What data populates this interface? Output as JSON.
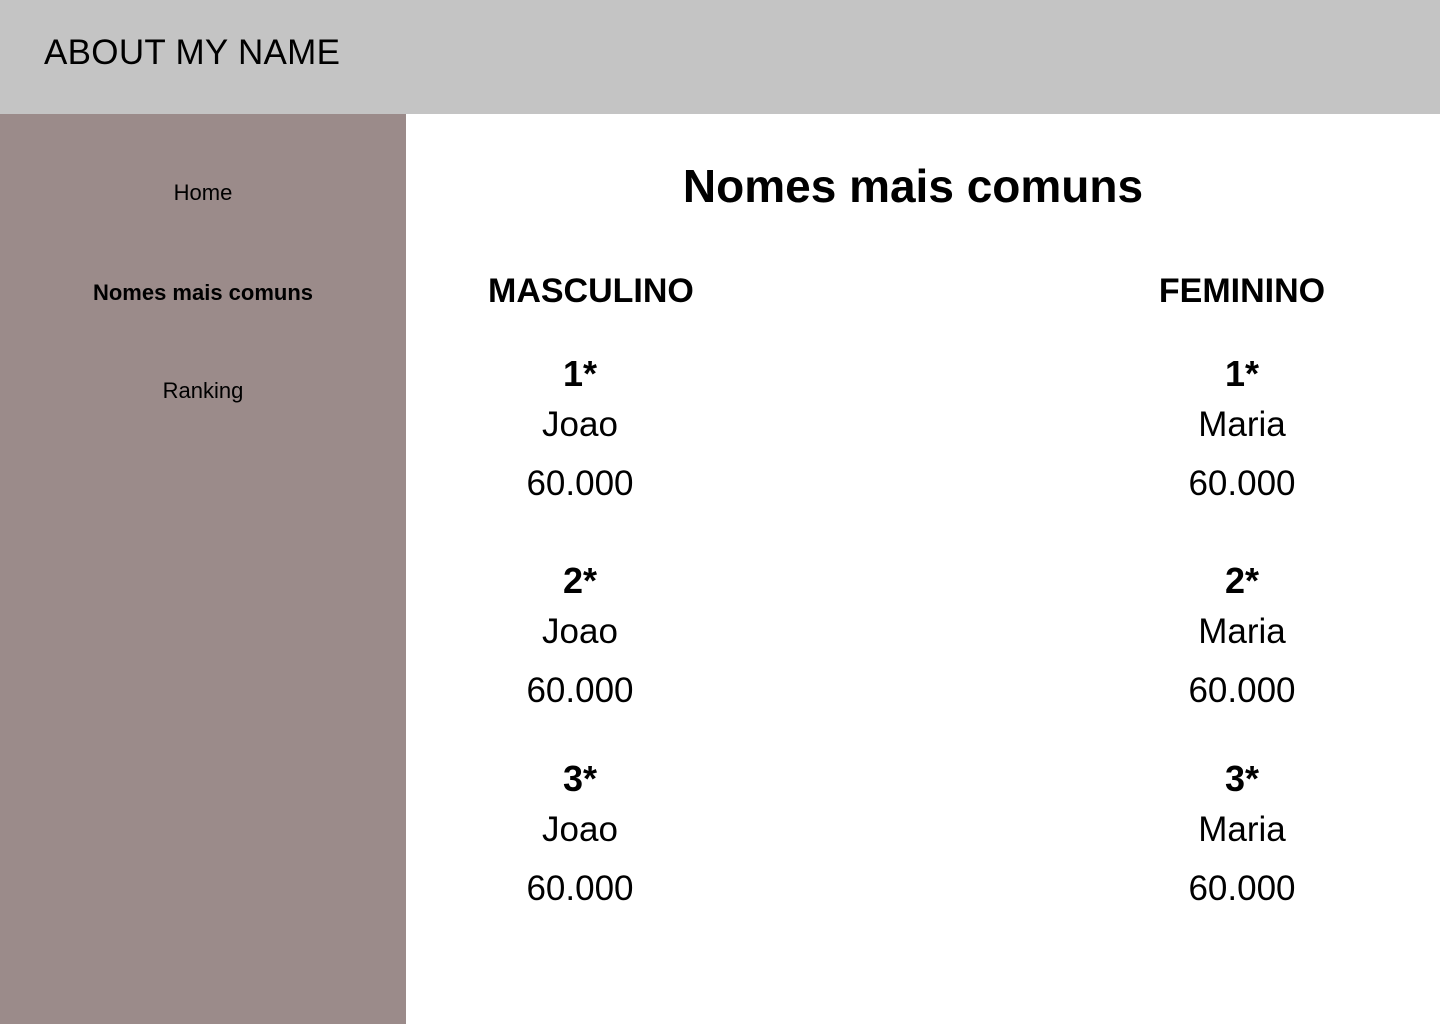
{
  "header": {
    "title": "ABOUT MY NAME"
  },
  "sidebar": {
    "items": [
      {
        "label": "Home",
        "active": false
      },
      {
        "label": "Nomes mais comuns",
        "active": true
      },
      {
        "label": "Ranking",
        "active": false
      }
    ]
  },
  "main": {
    "title": "Nomes mais comuns",
    "masculino": {
      "heading": "MASCULINO",
      "entries": [
        {
          "rank": "1*",
          "name": "Joao",
          "count": "60.000"
        },
        {
          "rank": "2*",
          "name": "Joao",
          "count": "60.000"
        },
        {
          "rank": "3*",
          "name": "Joao",
          "count": "60.000"
        }
      ]
    },
    "feminino": {
      "heading": "FEMININO",
      "entries": [
        {
          "rank": "1*",
          "name": "Maria",
          "count": "60.000"
        },
        {
          "rank": "2*",
          "name": "Maria",
          "count": "60.000"
        },
        {
          "rank": "3*",
          "name": "Maria",
          "count": "60.000"
        }
      ]
    }
  },
  "colors": {
    "header_bg": "#c4c4c4",
    "sidebar_bg": "#9b8b8a",
    "main_bg": "#ffffff",
    "text": "#000000"
  }
}
